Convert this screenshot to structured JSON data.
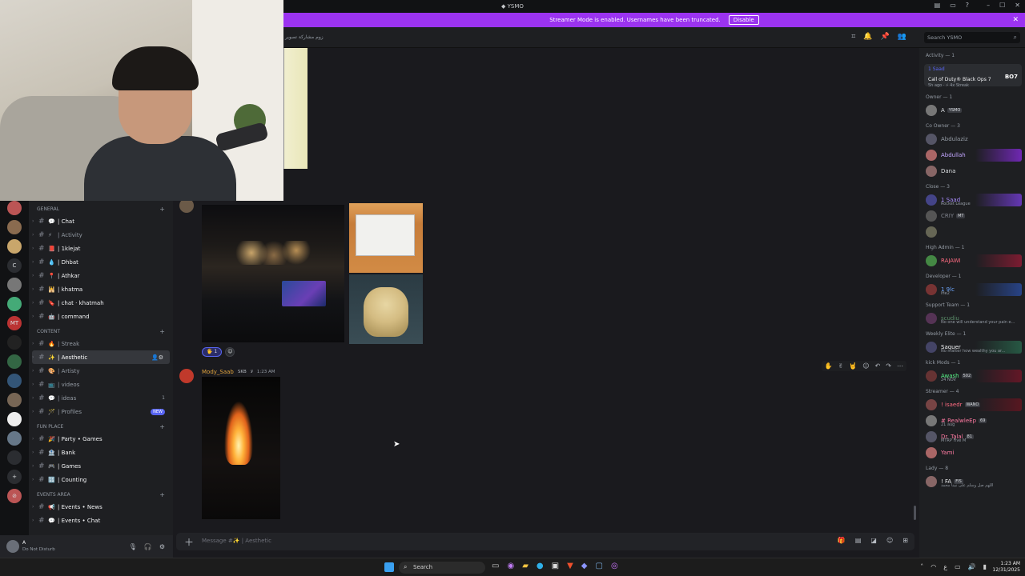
{
  "window": {
    "title": "YSMO",
    "title_icon": "discord-icon",
    "controls": [
      "–",
      "☐",
      "✕"
    ],
    "toolbar_icons": [
      "inbox-icon",
      "monitor-icon",
      "help-icon"
    ]
  },
  "streamer_banner": {
    "text": "Streamer Mode is enabled. Usernames have been truncated.",
    "button": "Disable",
    "close": "✕",
    "color": "#9b33f0"
  },
  "header": {
    "channel_text": "زوم مشاركة تصوير",
    "search_placeholder": "Search YSMO"
  },
  "servers": [
    "",
    "",
    "",
    "C",
    "",
    "",
    "MT",
    "",
    "",
    "",
    "",
    "",
    "",
    "",
    "+",
    "⊘"
  ],
  "channels": {
    "categories": [
      {
        "name": "GENERAL",
        "items": [
          {
            "emoji": "💬",
            "name": "| Chat",
            "bright": true
          },
          {
            "emoji": "⚡",
            "name": "| Activity",
            "bright": false
          },
          {
            "emoji": "📕",
            "name": "| 1klejat",
            "bright": true
          },
          {
            "emoji": "💧",
            "name": "| Dhbat",
            "bright": true
          },
          {
            "emoji": "📍",
            "name": "| Athkar",
            "bright": true
          },
          {
            "emoji": "🕌",
            "name": "| khatma",
            "bright": true
          },
          {
            "emoji": "🔖",
            "name": "| chat · khatmah",
            "bright": true
          },
          {
            "emoji": "🤖",
            "name": "| command",
            "bright": true
          }
        ]
      },
      {
        "name": "CONTENT",
        "items": [
          {
            "emoji": "🔥",
            "name": "| Streak",
            "bright": false
          },
          {
            "emoji": "✨",
            "name": "| Aesthetic",
            "bright": true,
            "active": true
          },
          {
            "emoji": "🎨",
            "name": "| Artisty",
            "bright": false
          },
          {
            "emoji": "📺",
            "name": "| videos",
            "bright": false
          },
          {
            "emoji": "💬",
            "name": "| ideas",
            "bright": false,
            "count": "1"
          },
          {
            "emoji": "🪄",
            "name": "| Profiles",
            "bright": false,
            "badge": "NEW"
          }
        ]
      },
      {
        "name": "FUN PLACE",
        "items": [
          {
            "emoji": "🎉",
            "name": "| Party • Games",
            "bright": true
          },
          {
            "emoji": "🏦",
            "name": "| Bank",
            "bright": true
          },
          {
            "emoji": "🎮",
            "name": "| Games",
            "bright": true
          },
          {
            "emoji": "🔢",
            "name": "| Counting",
            "bright": true
          }
        ]
      },
      {
        "name": "EVENTS AREA",
        "items": [
          {
            "emoji": "📢",
            "name": "| Events • News",
            "bright": true
          },
          {
            "emoji": "💬",
            "name": "| Events • Chat",
            "bright": true
          }
        ]
      }
    ]
  },
  "user": {
    "name": "A",
    "status": "Do Not Disturb"
  },
  "messages": {
    "reaction_count": "1",
    "author": "Mody_Saab",
    "author_tag": "SKB",
    "author_extra": "ﻻ",
    "time": "1:23 AM"
  },
  "composer": {
    "placeholder": "Message #✨ | Aesthetic"
  },
  "members": {
    "activity_title": "Activity — 1",
    "activity": {
      "user": "1 Saad",
      "game": "Call of Duty® Black Ops 7",
      "meta": "5h ago · ⚡ 4x Streak",
      "logo": "BO7"
    },
    "groups": [
      {
        "role": "Owner — 1",
        "members": [
          {
            "name": "A",
            "color": "#dbdee1",
            "tag": "YSMO"
          }
        ]
      },
      {
        "role": "Co Owner — 3",
        "members": [
          {
            "name": "Abdulaziz",
            "color": "#949ba4"
          },
          {
            "name": "Abdullah",
            "color": "#c3a6ff",
            "banner": "#8a2be2"
          },
          {
            "name": "Dana",
            "color": "#dbdee1"
          }
        ]
      },
      {
        "role": "Close — 3",
        "members": [
          {
            "name": "1 Saad",
            "color": "#a78bfa",
            "sub": "Rocket League",
            "banner": "#7b3fe4"
          },
          {
            "name": "CRIY",
            "color": "#80848e",
            "tag": "MT"
          },
          {
            "name": "",
            "color": "#949ba4"
          }
        ]
      },
      {
        "role": "High Admin — 1",
        "members": [
          {
            "name": "RAJAWI",
            "color": "#ff6b81",
            "banner": "#9b1b36"
          }
        ]
      },
      {
        "role": "Developer — 1",
        "members": [
          {
            "name": "1 9lc",
            "color": "#6fa8ff",
            "sub": "Ifie2",
            "banner": "#2b4fa8"
          }
        ]
      },
      {
        "role": "Support Team — 1",
        "members": [
          {
            "name": "scudiu",
            "color": "#5b8f6a",
            "sub": "No one will understand your pain e..."
          }
        ]
      },
      {
        "role": "Weekly Elite — 1",
        "members": [
          {
            "name": "Saquer",
            "color": "#f2f3f5",
            "sub": "No matter how wealthy you ar...",
            "banner": "#2a6b4f"
          }
        ]
      },
      {
        "role": "kick Mods — 1",
        "members": [
          {
            "name": "Awash",
            "color": "#57f287",
            "tag": "502",
            "sub": "24 NOV",
            "banner": "#7a1428"
          }
        ]
      },
      {
        "role": "Streamer — 4",
        "members": [
          {
            "name": "! isaedr",
            "color": "#ff6b81",
            "tag": "WANO",
            "banner": "#6b1420"
          },
          {
            "name": "# RealwleEp",
            "color": "#ff7aa2",
            "tag": "69",
            "sub": "21 aug"
          },
          {
            "name": "Dr. Talal",
            "color": "#ff7aa2",
            "tag": "81",
            "sub": "MTRP Five M"
          },
          {
            "name": "Yami",
            "color": "#ff7aa2"
          }
        ]
      },
      {
        "role": "Lady — 8",
        "members": [
          {
            "name": "! FA",
            "color": "#f2f3f5",
            "tag": "FIS",
            "sub": "اللهم صل وسلم على نبينا محمد"
          }
        ]
      }
    ]
  },
  "taskbar": {
    "search": "Search",
    "time": "1:23 AM",
    "date": "12/31/2025",
    "tray_lang": "ع"
  }
}
